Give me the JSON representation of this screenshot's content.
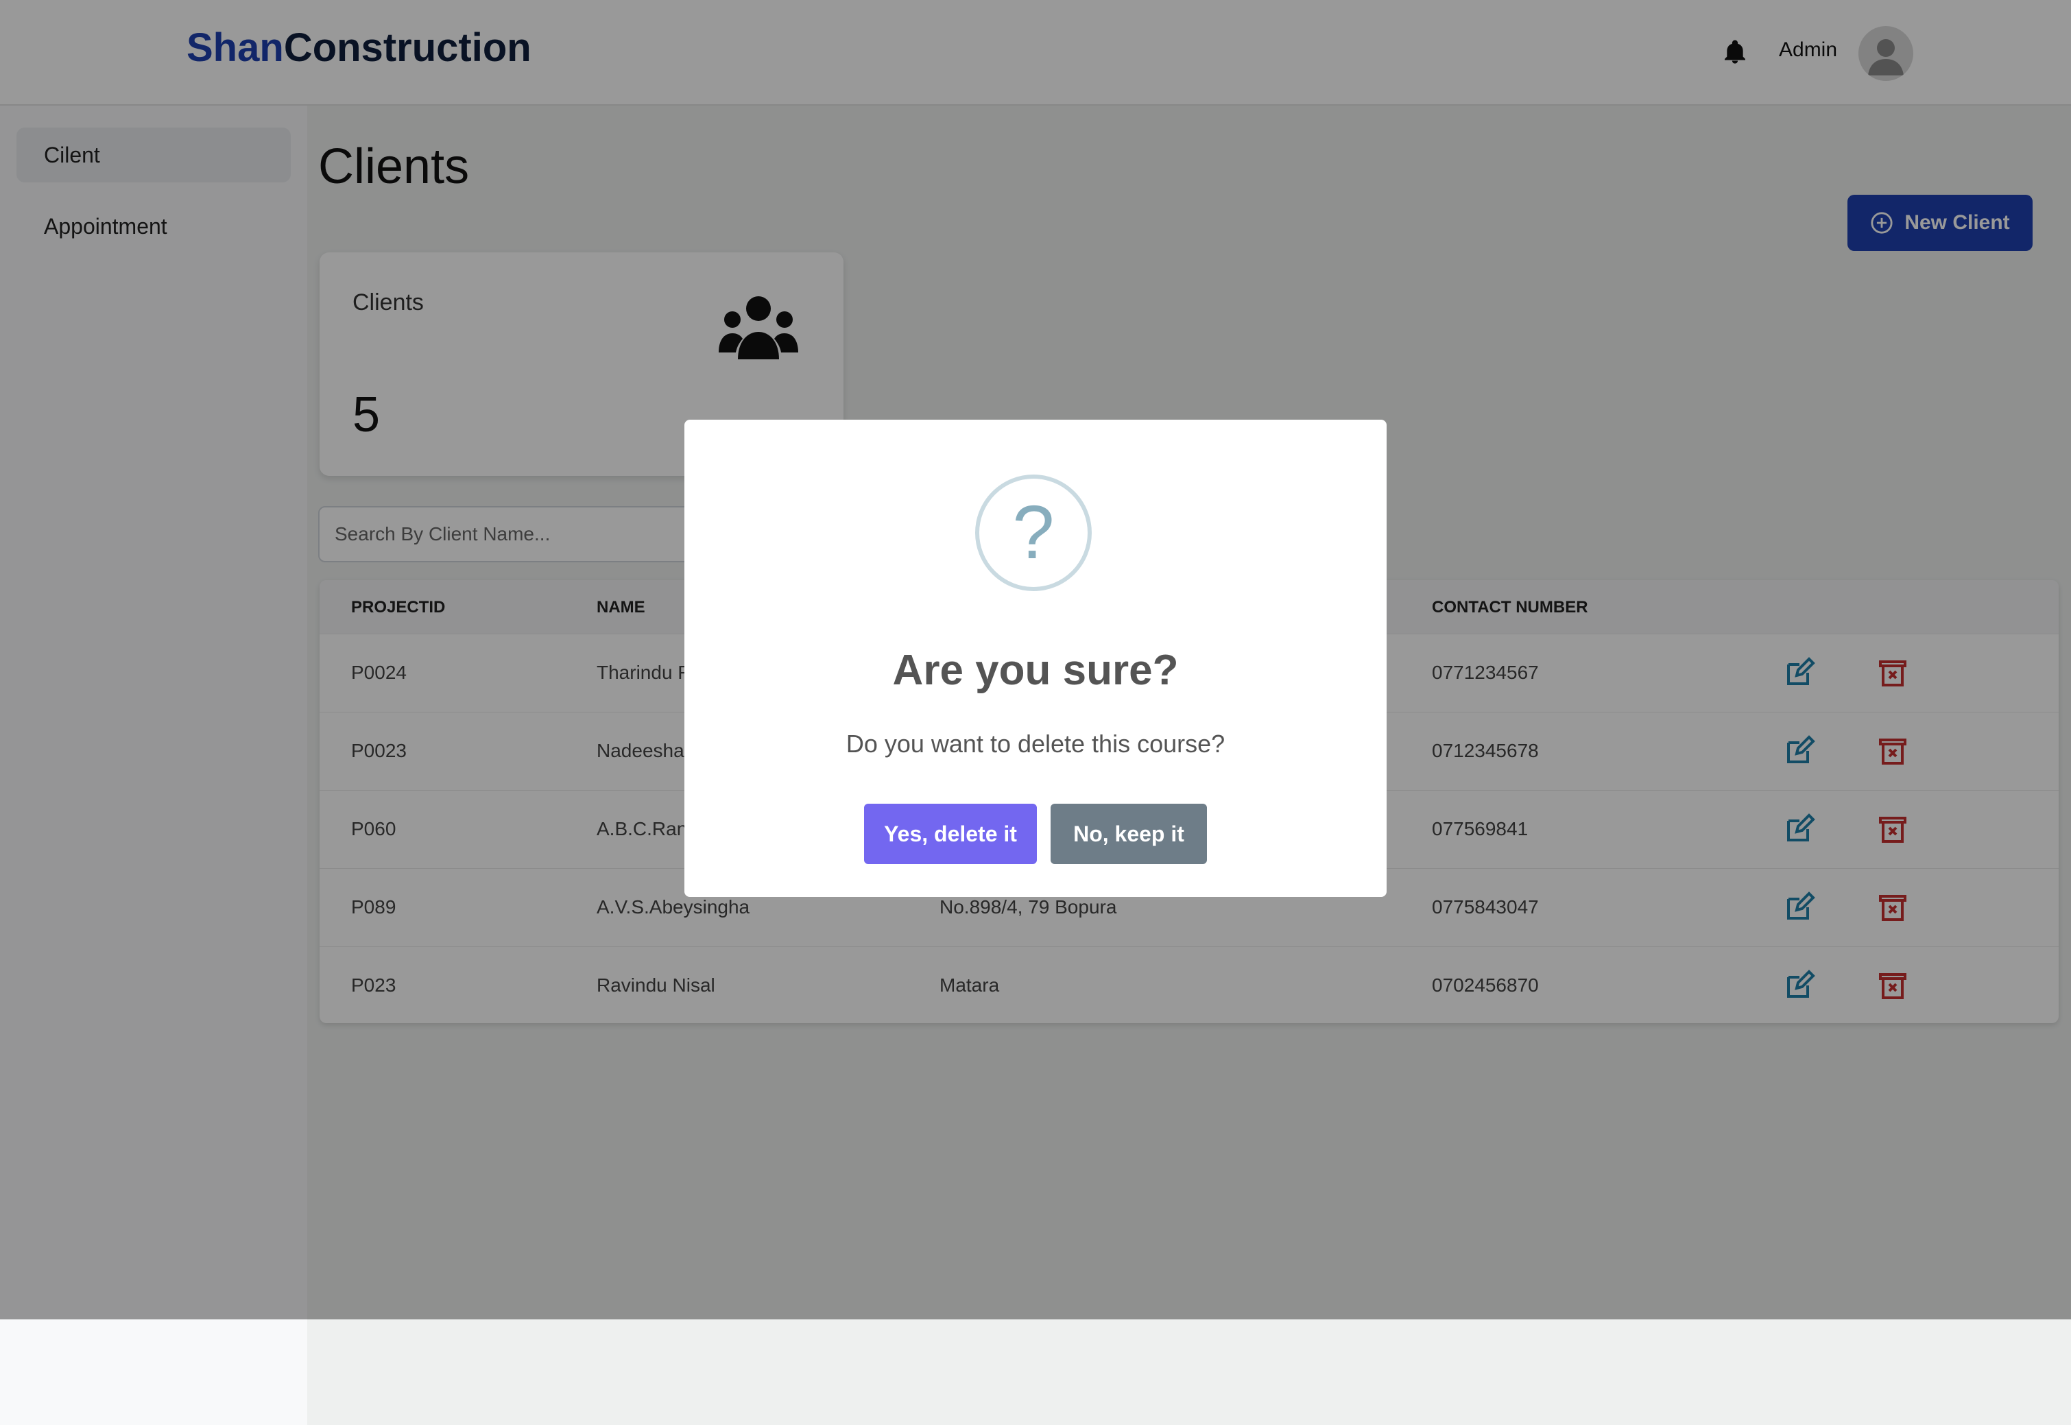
{
  "brand": {
    "part1": "Shan",
    "part2": "Construction"
  },
  "header": {
    "user_label": "Admin"
  },
  "sidebar": {
    "items": [
      {
        "label": "Cilent"
      },
      {
        "label": "Appointment"
      }
    ]
  },
  "main": {
    "title": "Clients",
    "new_client_label": "New Client",
    "stat": {
      "label": "Clients",
      "value": "5"
    },
    "search": {
      "placeholder": "Search By Client Name..."
    },
    "table": {
      "headers": [
        "PROJECTID",
        "NAME",
        "CONTACT NUMBER"
      ],
      "rows": [
        {
          "id": "P0024",
          "name": "Tharindu F",
          "address": "",
          "contact": "0771234567"
        },
        {
          "id": "P0023",
          "name": "Nadeesha",
          "address": "",
          "contact": "0712345678"
        },
        {
          "id": "P060",
          "name": "A.B.C.Rana",
          "address": "",
          "contact": "077569841"
        },
        {
          "id": "P089",
          "name": "A.V.S.Abeysingha",
          "address": "No.898/4, 79 Bopura",
          "contact": "0775843047"
        },
        {
          "id": "P023",
          "name": "Ravindu Nisal",
          "address": "Matara",
          "contact": "0702456870"
        }
      ]
    }
  },
  "modal": {
    "icon_glyph": "?",
    "title": "Are you sure?",
    "text": "Do you want to delete this course?",
    "confirm_label": "Yes, delete it",
    "cancel_label": "No, keep it"
  },
  "colors": {
    "brand_blue": "#1e40af",
    "confirm": "#7367f0",
    "cancel": "#6e7d88",
    "edit": "#1e7fa8",
    "delete": "#c53030"
  }
}
